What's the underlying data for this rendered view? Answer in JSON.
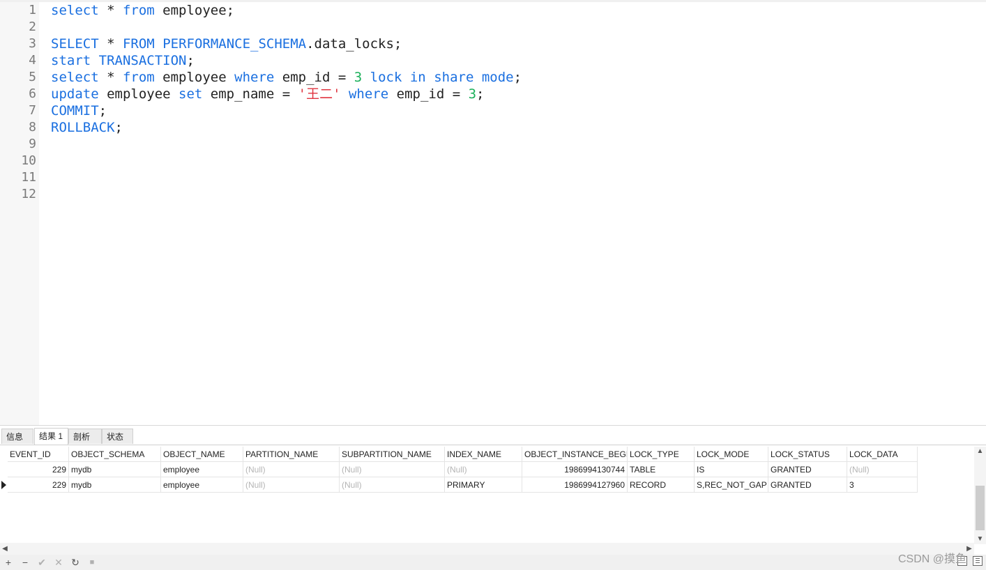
{
  "editor": {
    "lines": [
      {
        "n": "1",
        "tokens": [
          {
            "t": "select",
            "c": "kw"
          },
          {
            "t": " * ",
            "c": ""
          },
          {
            "t": "from",
            "c": "kw"
          },
          {
            "t": " employee;",
            "c": ""
          }
        ]
      },
      {
        "n": "2",
        "tokens": []
      },
      {
        "n": "3",
        "tokens": [
          {
            "t": "SELECT",
            "c": "kw"
          },
          {
            "t": " * ",
            "c": ""
          },
          {
            "t": "FROM",
            "c": "kw"
          },
          {
            "t": " ",
            "c": ""
          },
          {
            "t": "PERFORMANCE_SCHEMA",
            "c": "kw"
          },
          {
            "t": ".data_locks;",
            "c": ""
          }
        ]
      },
      {
        "n": "4",
        "tokens": [
          {
            "t": "start",
            "c": "kw"
          },
          {
            "t": " ",
            "c": ""
          },
          {
            "t": "TRANSACTION",
            "c": "kw"
          },
          {
            "t": ";",
            "c": ""
          }
        ]
      },
      {
        "n": "5",
        "tokens": [
          {
            "t": "select",
            "c": "kw"
          },
          {
            "t": " * ",
            "c": ""
          },
          {
            "t": "from",
            "c": "kw"
          },
          {
            "t": " employee ",
            "c": ""
          },
          {
            "t": "where",
            "c": "kw"
          },
          {
            "t": " emp_id = ",
            "c": ""
          },
          {
            "t": "3",
            "c": "num"
          },
          {
            "t": " ",
            "c": ""
          },
          {
            "t": "lock",
            "c": "kw"
          },
          {
            "t": " ",
            "c": ""
          },
          {
            "t": "in",
            "c": "kw"
          },
          {
            "t": " ",
            "c": ""
          },
          {
            "t": "share",
            "c": "kw"
          },
          {
            "t": " ",
            "c": ""
          },
          {
            "t": "mode",
            "c": "kw"
          },
          {
            "t": ";",
            "c": ""
          }
        ]
      },
      {
        "n": "6",
        "tokens": [
          {
            "t": "update",
            "c": "kw"
          },
          {
            "t": " employee ",
            "c": ""
          },
          {
            "t": "set",
            "c": "kw"
          },
          {
            "t": " emp_name = ",
            "c": ""
          },
          {
            "t": "'王二'",
            "c": "str"
          },
          {
            "t": " ",
            "c": ""
          },
          {
            "t": "where",
            "c": "kw"
          },
          {
            "t": " emp_id = ",
            "c": ""
          },
          {
            "t": "3",
            "c": "num"
          },
          {
            "t": ";",
            "c": ""
          }
        ]
      },
      {
        "n": "7",
        "tokens": [
          {
            "t": "COMMIT",
            "c": "kw"
          },
          {
            "t": ";",
            "c": ""
          }
        ]
      },
      {
        "n": "8",
        "tokens": [
          {
            "t": "ROLLBACK",
            "c": "kw"
          },
          {
            "t": ";",
            "c": ""
          }
        ]
      },
      {
        "n": "9",
        "tokens": []
      },
      {
        "n": "10",
        "tokens": []
      },
      {
        "n": "11",
        "tokens": []
      },
      {
        "n": "12",
        "tokens": []
      }
    ]
  },
  "tabs": [
    {
      "label": "信息",
      "active": false
    },
    {
      "label": "结果 1",
      "active": true
    },
    {
      "label": "剖析",
      "active": false
    },
    {
      "label": "状态",
      "active": false
    }
  ],
  "result": {
    "columns": [
      "EVENT_ID",
      "OBJECT_SCHEMA",
      "OBJECT_NAME",
      "PARTITION_NAME",
      "SUBPARTITION_NAME",
      "INDEX_NAME",
      "OBJECT_INSTANCE_BEGIN",
      "LOCK_TYPE",
      "LOCK_MODE",
      "LOCK_STATUS",
      "LOCK_DATA"
    ],
    "rows": [
      [
        "229",
        "mydb",
        "employee",
        "(Null)",
        "(Null)",
        "(Null)",
        "1986994130744",
        "TABLE",
        "IS",
        "GRANTED",
        "(Null)"
      ],
      [
        "229",
        "mydb",
        "employee",
        "(Null)",
        "(Null)",
        "PRIMARY",
        "1986994127960",
        "RECORD",
        "S,REC_NOT_GAP",
        "GRANTED",
        "3"
      ]
    ],
    "current_row": 1
  },
  "toolbar": {
    "add": "+",
    "delete": "−",
    "apply": "✔",
    "discard": "✕",
    "refresh": "↻",
    "stop": "■"
  },
  "watermark": "CSDN @摸鱼"
}
